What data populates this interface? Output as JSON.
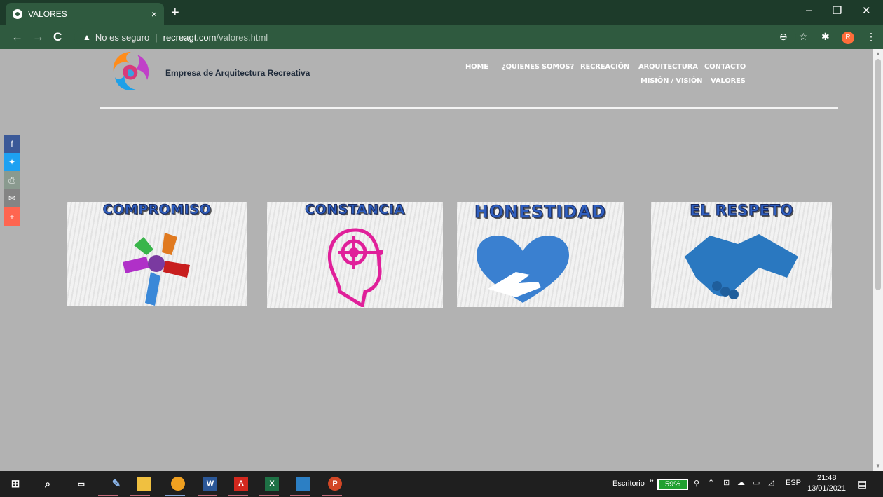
{
  "browser": {
    "tab_title": "VALORES",
    "tab_close": "×",
    "new_tab": "+",
    "security_warning": "No es seguro",
    "url_host": "recreagt.com",
    "url_path": "/valores.html",
    "profile_initial": "R",
    "window_controls": [
      "–",
      "❐",
      "✕"
    ]
  },
  "site": {
    "brand": "Empresa de Arquitectura Recreativa",
    "menu": [
      {
        "label": "HOME"
      },
      {
        "label": "¿QUIENES SOMOS?"
      },
      {
        "label": "RECREACIÓN"
      },
      {
        "label": "ARQUITECTURA"
      },
      {
        "label": "CONTACTO"
      },
      {
        "label": "MISIÓN / VISIÓN"
      },
      {
        "label": "VALORES"
      }
    ],
    "share_buttons": [
      {
        "icon": "facebook-icon",
        "glyph": "f",
        "color": "#3b5998"
      },
      {
        "icon": "twitter-icon",
        "glyph": "🐦",
        "color": "#1da1f2"
      },
      {
        "icon": "print-icon",
        "glyph": "⎙",
        "color": "#8a9a8f"
      },
      {
        "icon": "email-icon",
        "glyph": "✉",
        "color": "#848484"
      },
      {
        "icon": "more-icon",
        "glyph": "+",
        "color": "#ff6550"
      }
    ],
    "values": [
      {
        "title": "COMPROMISO",
        "icon": "hands-icon"
      },
      {
        "title": "CONSTANCIA",
        "icon": "head-target-icon"
      },
      {
        "title": "HONESTIDAD",
        "icon": "heart-hand-icon"
      },
      {
        "title": "EL RESPETO",
        "icon": "handshake-icon"
      }
    ]
  },
  "taskbar": {
    "apps": [
      "start-icon",
      "search-icon",
      "task-view-icon",
      "paint-icon",
      "file-explorer-icon",
      "chrome-icon",
      "word-icon",
      "acrobat-icon",
      "excel-icon",
      "photos-icon",
      "powerpoint-icon"
    ],
    "desktop_label": "Escritorio",
    "battery": "59%",
    "language": "ESP",
    "time": "21:48",
    "date": "13/01/2021"
  }
}
